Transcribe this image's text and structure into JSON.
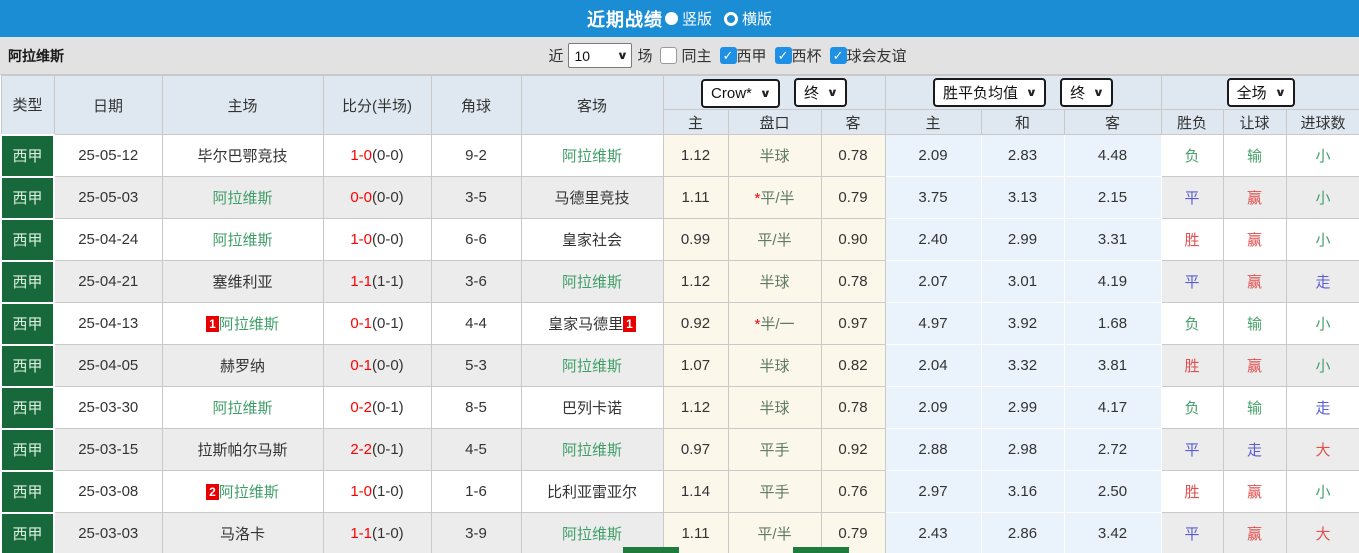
{
  "header": {
    "title": "近期战绩",
    "vertical_label": "竖版",
    "horizontal_label": "横版"
  },
  "filter": {
    "team": "阿拉维斯",
    "recent_label": "近",
    "count_value": "10",
    "matches_label": "场",
    "same_home_label": "同主",
    "league_labels": [
      "西甲",
      "西杯",
      "球会友谊"
    ]
  },
  "table": {
    "col_headers": {
      "type": "类型",
      "date": "日期",
      "home": "主场",
      "score": "比分(半场)",
      "corner": "角球",
      "away": "客场"
    },
    "group_selects": {
      "odds_company": "Crow*",
      "odds_time": "终",
      "avg_label": "胜平负均值",
      "avg_time": "终",
      "scope": "全场"
    },
    "sub_headers": {
      "odds_home": "主",
      "odds_handicap": "盘口",
      "odds_away": "客",
      "avg_home": "主",
      "avg_draw": "和",
      "avg_away": "客",
      "result_wdl": "胜负",
      "result_handicap": "让球",
      "result_goals": "进球数"
    },
    "rows": [
      {
        "type": "西甲",
        "date": "25-05-12",
        "home": "毕尔巴鄂竞技",
        "home_is_team": false,
        "home_badge": "",
        "score_ft": "1-0",
        "score_ht": "(0-0)",
        "corner": "9-2",
        "away": "阿拉维斯",
        "away_is_team": true,
        "away_badge": "",
        "odds_home": "1.12",
        "handicap": "半球",
        "handicap_star": false,
        "odds_away": "0.78",
        "avg_home": "2.09",
        "avg_draw": "2.83",
        "avg_away": "4.48",
        "res_wdl": {
          "t": "负",
          "c": "green"
        },
        "res_handicap": {
          "t": "输",
          "c": "green"
        },
        "res_goals": {
          "t": "小",
          "c": "green"
        }
      },
      {
        "type": "西甲",
        "date": "25-05-03",
        "home": "阿拉维斯",
        "home_is_team": true,
        "home_badge": "",
        "score_ft": "0-0",
        "score_ht": "(0-0)",
        "corner": "3-5",
        "away": "马德里竞技",
        "away_is_team": false,
        "away_badge": "",
        "odds_home": "1.11",
        "handicap": "平/半",
        "handicap_star": true,
        "odds_away": "0.79",
        "avg_home": "3.75",
        "avg_draw": "3.13",
        "avg_away": "2.15",
        "res_wdl": {
          "t": "平",
          "c": "blue"
        },
        "res_handicap": {
          "t": "赢",
          "c": "red"
        },
        "res_goals": {
          "t": "小",
          "c": "green"
        }
      },
      {
        "type": "西甲",
        "date": "25-04-24",
        "home": "阿拉维斯",
        "home_is_team": true,
        "home_badge": "",
        "score_ft": "1-0",
        "score_ht": "(0-0)",
        "corner": "6-6",
        "away": "皇家社会",
        "away_is_team": false,
        "away_badge": "",
        "odds_home": "0.99",
        "handicap": "平/半",
        "handicap_star": false,
        "odds_away": "0.90",
        "avg_home": "2.40",
        "avg_draw": "2.99",
        "avg_away": "3.31",
        "res_wdl": {
          "t": "胜",
          "c": "red"
        },
        "res_handicap": {
          "t": "赢",
          "c": "red"
        },
        "res_goals": {
          "t": "小",
          "c": "green"
        }
      },
      {
        "type": "西甲",
        "date": "25-04-21",
        "home": "塞维利亚",
        "home_is_team": false,
        "home_badge": "",
        "score_ft": "1-1",
        "score_ht": "(1-1)",
        "corner": "3-6",
        "away": "阿拉维斯",
        "away_is_team": true,
        "away_badge": "",
        "odds_home": "1.12",
        "handicap": "半球",
        "handicap_star": false,
        "odds_away": "0.78",
        "avg_home": "2.07",
        "avg_draw": "3.01",
        "avg_away": "4.19",
        "res_wdl": {
          "t": "平",
          "c": "blue"
        },
        "res_handicap": {
          "t": "赢",
          "c": "red"
        },
        "res_goals": {
          "t": "走",
          "c": "blue"
        }
      },
      {
        "type": "西甲",
        "date": "25-04-13",
        "home": "阿拉维斯",
        "home_is_team": true,
        "home_badge": "1",
        "score_ft": "0-1",
        "score_ht": "(0-1)",
        "corner": "4-4",
        "away": "皇家马德里",
        "away_is_team": false,
        "away_badge": "1",
        "odds_home": "0.92",
        "handicap": "半/一",
        "handicap_star": true,
        "odds_away": "0.97",
        "avg_home": "4.97",
        "avg_draw": "3.92",
        "avg_away": "1.68",
        "res_wdl": {
          "t": "负",
          "c": "green"
        },
        "res_handicap": {
          "t": "输",
          "c": "green"
        },
        "res_goals": {
          "t": "小",
          "c": "green"
        }
      },
      {
        "type": "西甲",
        "date": "25-04-05",
        "home": "赫罗纳",
        "home_is_team": false,
        "home_badge": "",
        "score_ft": "0-1",
        "score_ht": "(0-0)",
        "corner": "5-3",
        "away": "阿拉维斯",
        "away_is_team": true,
        "away_badge": "",
        "odds_home": "1.07",
        "handicap": "半球",
        "handicap_star": false,
        "odds_away": "0.82",
        "avg_home": "2.04",
        "avg_draw": "3.32",
        "avg_away": "3.81",
        "res_wdl": {
          "t": "胜",
          "c": "red"
        },
        "res_handicap": {
          "t": "赢",
          "c": "red"
        },
        "res_goals": {
          "t": "小",
          "c": "green"
        }
      },
      {
        "type": "西甲",
        "date": "25-03-30",
        "home": "阿拉维斯",
        "home_is_team": true,
        "home_badge": "",
        "score_ft": "0-2",
        "score_ht": "(0-1)",
        "corner": "8-5",
        "away": "巴列卡诺",
        "away_is_team": false,
        "away_badge": "",
        "odds_home": "1.12",
        "handicap": "半球",
        "handicap_star": false,
        "odds_away": "0.78",
        "avg_home": "2.09",
        "avg_draw": "2.99",
        "avg_away": "4.17",
        "res_wdl": {
          "t": "负",
          "c": "green"
        },
        "res_handicap": {
          "t": "输",
          "c": "green"
        },
        "res_goals": {
          "t": "走",
          "c": "blue"
        }
      },
      {
        "type": "西甲",
        "date": "25-03-15",
        "home": "拉斯帕尔马斯",
        "home_is_team": false,
        "home_badge": "",
        "score_ft": "2-2",
        "score_ht": "(0-1)",
        "corner": "4-5",
        "away": "阿拉维斯",
        "away_is_team": true,
        "away_badge": "",
        "odds_home": "0.97",
        "handicap": "平手",
        "handicap_star": false,
        "odds_away": "0.92",
        "avg_home": "2.88",
        "avg_draw": "2.98",
        "avg_away": "2.72",
        "res_wdl": {
          "t": "平",
          "c": "blue"
        },
        "res_handicap": {
          "t": "走",
          "c": "blue"
        },
        "res_goals": {
          "t": "大",
          "c": "red"
        }
      },
      {
        "type": "西甲",
        "date": "25-03-08",
        "home": "阿拉维斯",
        "home_is_team": true,
        "home_badge": "2",
        "score_ft": "1-0",
        "score_ht": "(1-0)",
        "corner": "1-6",
        "away": "比利亚雷亚尔",
        "away_is_team": false,
        "away_badge": "",
        "odds_home": "1.14",
        "handicap": "平手",
        "handicap_star": false,
        "odds_away": "0.76",
        "avg_home": "2.97",
        "avg_draw": "3.16",
        "avg_away": "2.50",
        "res_wdl": {
          "t": "胜",
          "c": "red"
        },
        "res_handicap": {
          "t": "赢",
          "c": "red"
        },
        "res_goals": {
          "t": "小",
          "c": "green"
        }
      },
      {
        "type": "西甲",
        "date": "25-03-03",
        "home": "马洛卡",
        "home_is_team": false,
        "home_badge": "",
        "score_ft": "1-1",
        "score_ht": "(1-0)",
        "corner": "3-9",
        "away": "阿拉维斯",
        "away_is_team": true,
        "away_badge": "",
        "odds_home": "1.11",
        "handicap": "平/半",
        "handicap_star": false,
        "odds_away": "0.79",
        "avg_home": "2.43",
        "avg_draw": "2.86",
        "avg_away": "3.42",
        "res_wdl": {
          "t": "平",
          "c": "blue"
        },
        "res_handicap": {
          "t": "赢",
          "c": "red"
        },
        "res_goals": {
          "t": "大",
          "c": "red"
        }
      }
    ]
  },
  "colors": {
    "topbar_blue": "#1b8dd4",
    "checkbox_blue": "#1e90e6",
    "type_green_bg": "#17693c",
    "team_green": "#3f9e68",
    "score_red": "#ff0000",
    "result_red": "#e14f4f",
    "result_blue": "#5b5bd6",
    "result_green": "#47a06b",
    "crow_bg": "#fcf7eb",
    "avg_bg": "#eaf3fb"
  }
}
